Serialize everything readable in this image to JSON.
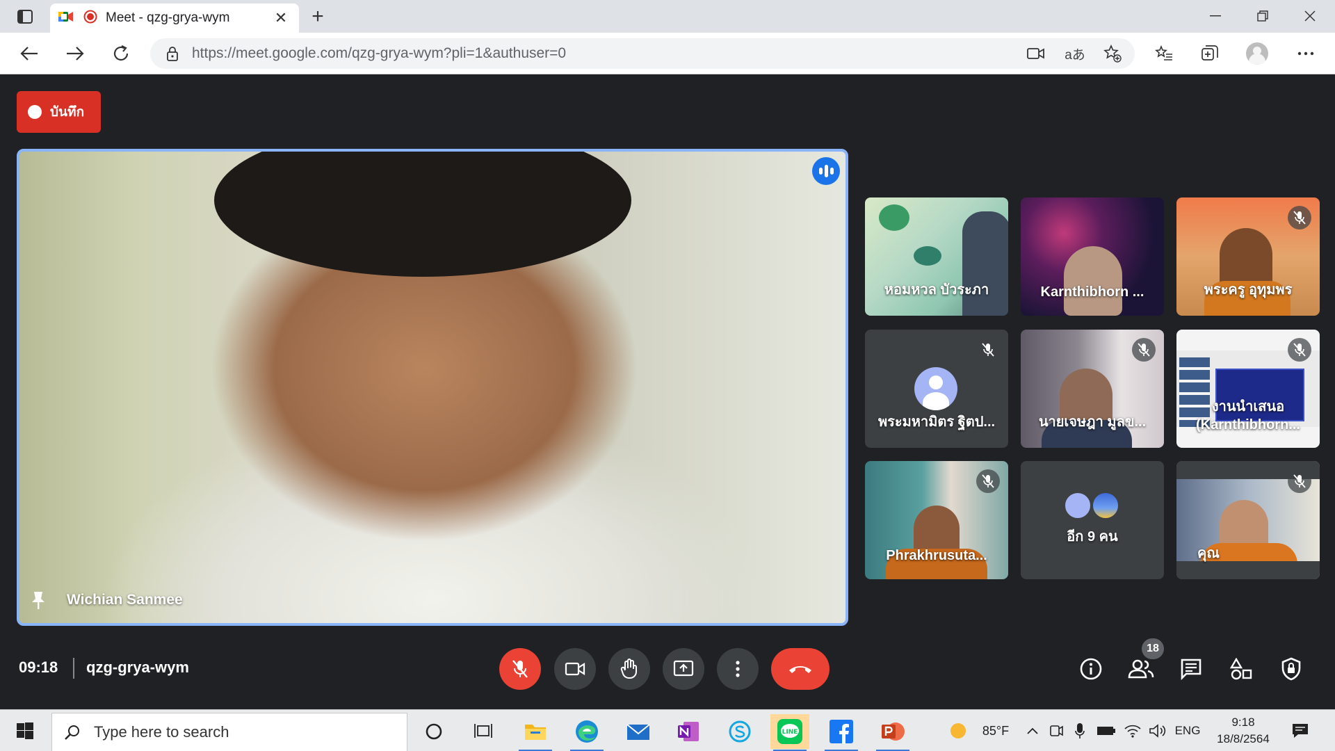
{
  "browser": {
    "tab": {
      "title": "Meet - qzg-grya-wym",
      "close": "✕"
    },
    "new_tab": "+",
    "url": "https://meet.google.com/qzg-grya-wym?pli=1&authuser=0",
    "translate_label": "aあ",
    "window_controls": [
      "minimize-icon",
      "restore-icon",
      "close-icon"
    ]
  },
  "meet": {
    "recording_label": "บันทึก",
    "main_speaker": {
      "name": "Wichian Sanmee"
    },
    "participants": [
      {
        "name": "หอมหวล บัวระภา",
        "muted": false
      },
      {
        "name": "Karnthibhorn ...",
        "muted": false
      },
      {
        "name": "พระครู อุทุมพร",
        "muted": true
      },
      {
        "name": "พระมหามิตร ฐิตป...",
        "muted": true
      },
      {
        "name": "นายเจษฎา มูลข...",
        "muted": true
      },
      {
        "name": "งานนำเสนอ (Karnthibhorn...",
        "muted": true
      },
      {
        "name": "Phrakhrusuta...",
        "muted": true
      },
      {
        "name": "อีก 9 คน",
        "muted": false
      },
      {
        "name": "คุณ",
        "muted": true
      }
    ],
    "time": "09:18",
    "meeting_code": "qzg-grya-wym",
    "participant_count": "18",
    "colors": {
      "end_call": "#ea4335",
      "accent": "#8ab4f8",
      "record": "#d93025"
    }
  },
  "taskbar": {
    "search_placeholder": "Type here to search",
    "weather": "85°F",
    "language": "ENG",
    "time": "9:18",
    "date": "18/8/2564"
  }
}
